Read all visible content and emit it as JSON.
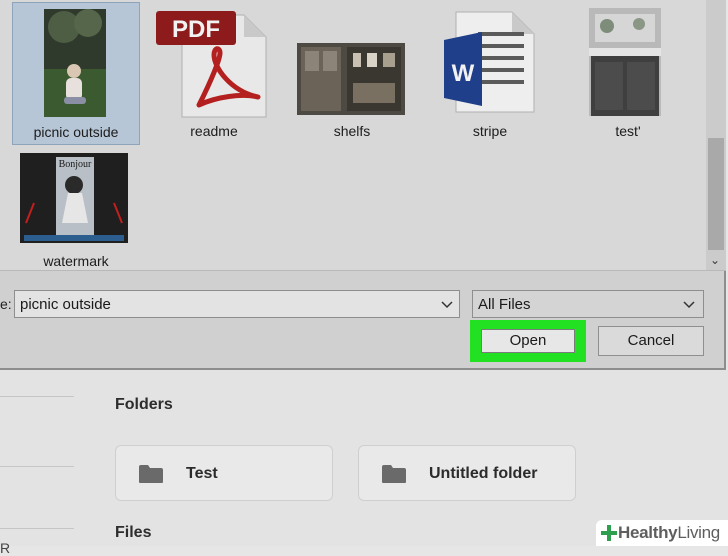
{
  "dialog": {
    "files": [
      {
        "label": "picnic outside",
        "kind": "photo",
        "selected": true
      },
      {
        "label": "readme",
        "kind": "pdf",
        "badge_text": "PDF",
        "selected": false
      },
      {
        "label": "shelfs",
        "kind": "photo",
        "selected": false
      },
      {
        "label": "stripe",
        "kind": "word",
        "badge_text": "W",
        "selected": false
      },
      {
        "label": "test'",
        "kind": "photo",
        "selected": false
      },
      {
        "label": "watermark",
        "kind": "photo",
        "thumb_text": "Bonjour",
        "selected": false
      }
    ],
    "file_name_label": "e:",
    "file_name_value": "picnic outside",
    "file_type_value": "All Files",
    "open_label": "Open",
    "cancel_label": "Cancel",
    "highlight_color": "#22e022"
  },
  "background_page": {
    "folders_heading": "Folders",
    "folders": [
      {
        "name": "Test"
      },
      {
        "name": "Untitled folder"
      }
    ],
    "files_heading": "Files",
    "cut_text": "R"
  },
  "watermark_brand": {
    "part1": "Healthy",
    "part2": "Living",
    "icon": "plus-icon",
    "accent": "#2e9e4f"
  }
}
